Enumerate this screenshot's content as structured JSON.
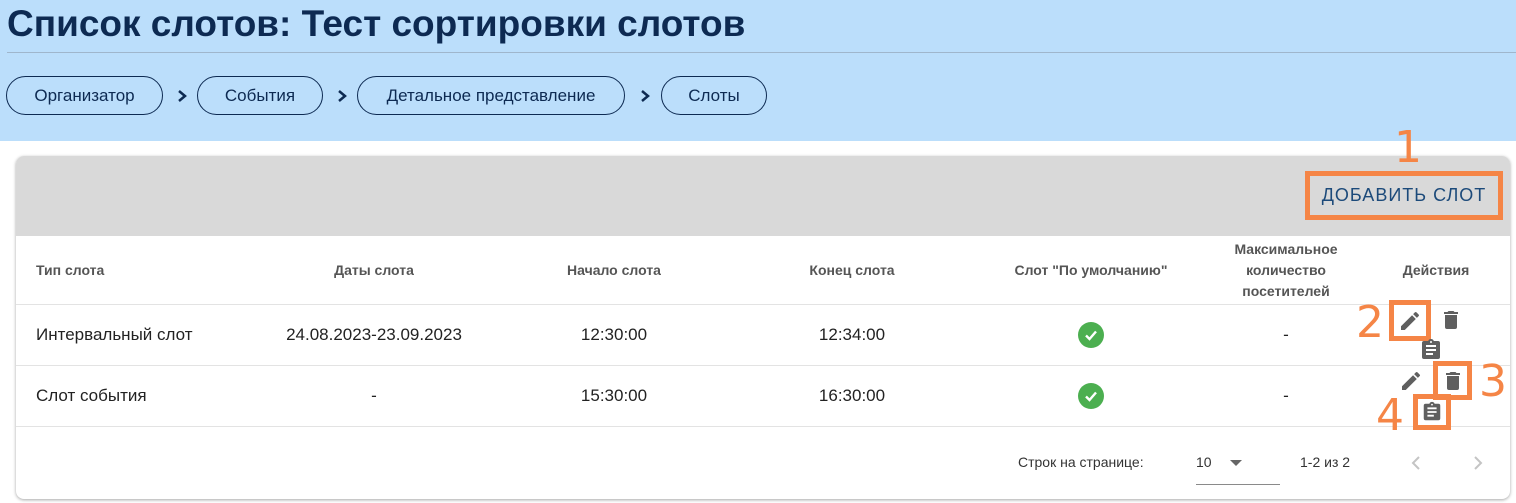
{
  "header": {
    "title": "Список слотов: Тест сортировки слотов",
    "breadcrumbs": [
      {
        "label": "Организатор"
      },
      {
        "label": "События"
      },
      {
        "label": "Детальное представление"
      },
      {
        "label": "Слоты"
      }
    ]
  },
  "toolbar": {
    "add_label": "ДОБАВИТЬ СЛОТ"
  },
  "table": {
    "columns": [
      "Тип слота",
      "Даты слота",
      "Начало слота",
      "Конец слота",
      "Слот \"По умолчанию\"",
      "Максимальное количество посетителей",
      "Действия"
    ],
    "rows": [
      {
        "type": "Интервальный слот",
        "dates": "24.08.2023-23.09.2023",
        "start": "12:30:00",
        "end": "12:34:00",
        "default": true,
        "max_visitors": "-"
      },
      {
        "type": "Слот события",
        "dates": "-",
        "start": "15:30:00",
        "end": "16:30:00",
        "default": true,
        "max_visitors": "-"
      }
    ]
  },
  "pagination": {
    "rows_per_page_label": "Строк на странице:",
    "rows_per_page_value": "10",
    "range": "1-2 из 2"
  },
  "annotations": [
    "1",
    "2",
    "3",
    "4"
  ],
  "colors": {
    "header_bg": "#bbdefb",
    "highlight": "#f58546",
    "check": "#4caf50",
    "title": "#0d2a52"
  }
}
